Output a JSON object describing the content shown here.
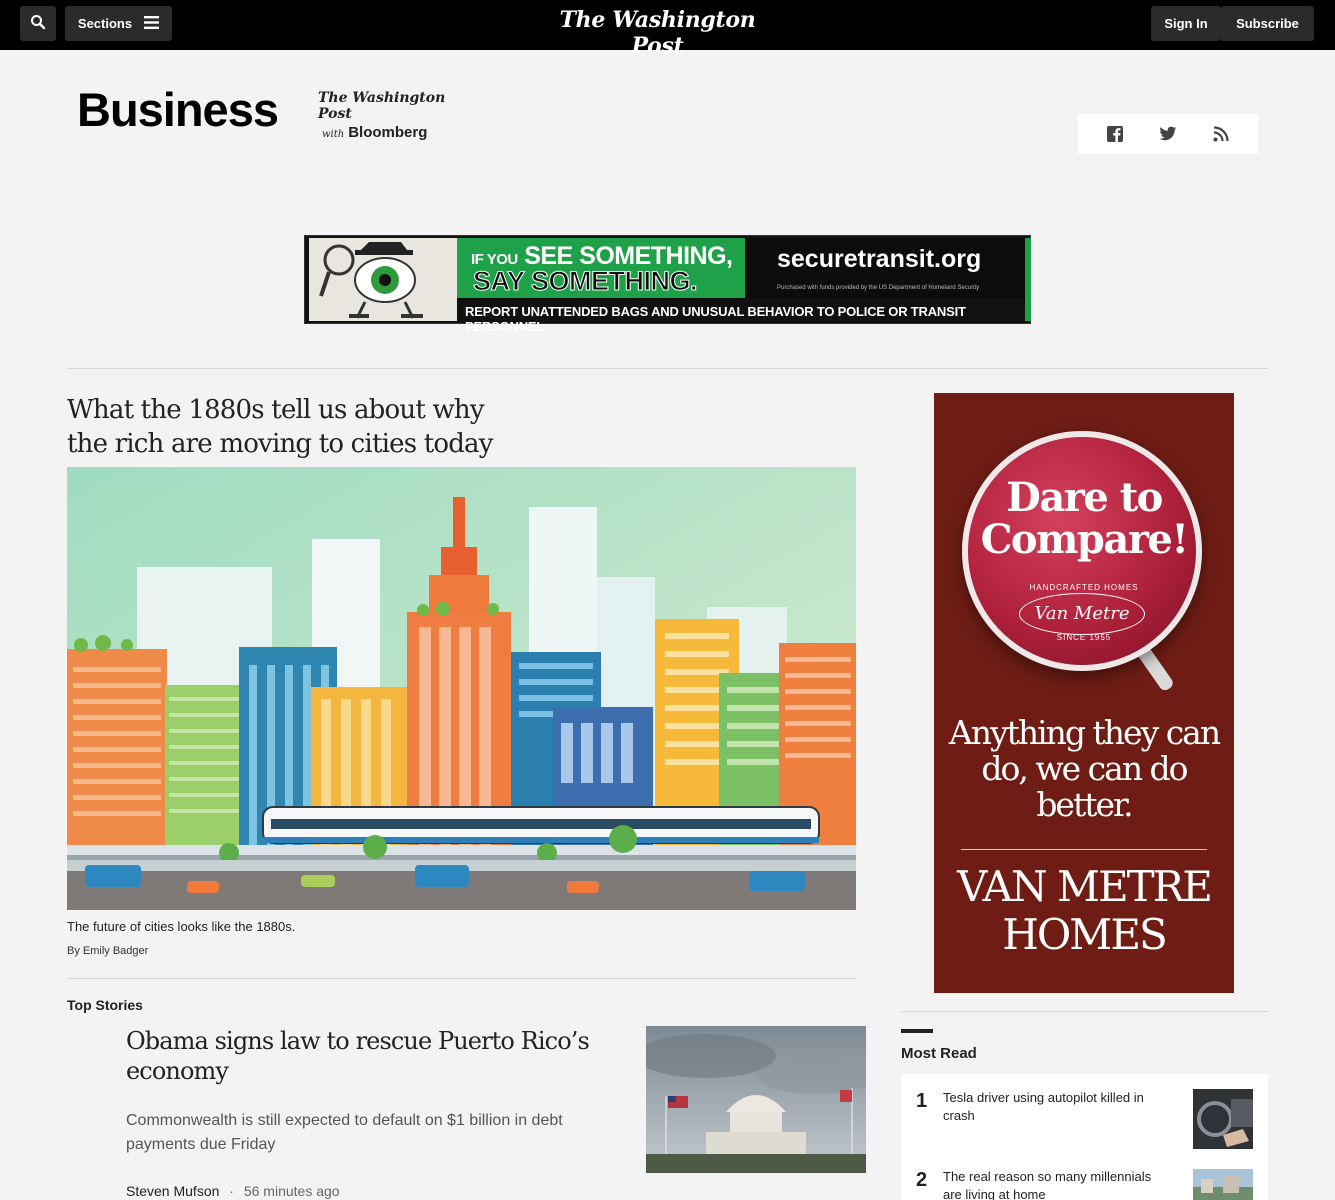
{
  "topbar": {
    "sections_label": "Sections",
    "masthead": "The Washington Post",
    "signin_label": "Sign In",
    "subscribe_label": "Subscribe"
  },
  "section": {
    "title": "Business",
    "partner_name": "The Washington Post",
    "partner_with": "with",
    "partner_bloomberg": "Bloomberg"
  },
  "social": {
    "icons": [
      "facebook-icon",
      "twitter-icon",
      "rss-icon"
    ]
  },
  "banner_ad": {
    "line_prefix": "IF YOU",
    "line1": "SEE SOMETHING,",
    "line2": "SAY SOMETHING.",
    "site": "securetransit.org",
    "fine_print": "Purchased with funds provided by the US Department of Homeland Security",
    "report": "REPORT UNATTENDED BAGS  AND UNUSUAL BEHAVIOR TO POLICE OR TRANSIT PERSONNEL"
  },
  "lead": {
    "headline": "What the 1880s tell us about why the rich are moving to cities today",
    "caption": "The future of cities looks like the 1880s.",
    "byline": "By Emily Badger"
  },
  "top_stories": {
    "label": "Top Stories",
    "items": [
      {
        "headline": "Obama signs law to rescue Puerto Rico’s economy",
        "blurb": "Commonwealth is still expected to default on $1 billion in debt payments due Friday",
        "author": "Steven Mufson",
        "separator": "·",
        "time": "56 minutes ago"
      }
    ]
  },
  "side_ad": {
    "headline": "Dare to Compare!",
    "handcrafted": "HANDCRAFTED HOMES",
    "script": "Van Metre",
    "since": "SINCE 1955",
    "tagline": "Anything they can do, we can do better.",
    "brand": "VAN METRE HOMES"
  },
  "most_read": {
    "label": "Most Read",
    "items": [
      {
        "rank": "1",
        "title": "Tesla driver using autopilot killed in crash"
      },
      {
        "rank": "2",
        "title": "The real reason so many millennials are living at home"
      }
    ]
  },
  "colors": {
    "topbar": "#000000",
    "page_bg": "#f3f3f3",
    "ad_red": "#6f1d14",
    "ad_green": "#1fa14a"
  }
}
